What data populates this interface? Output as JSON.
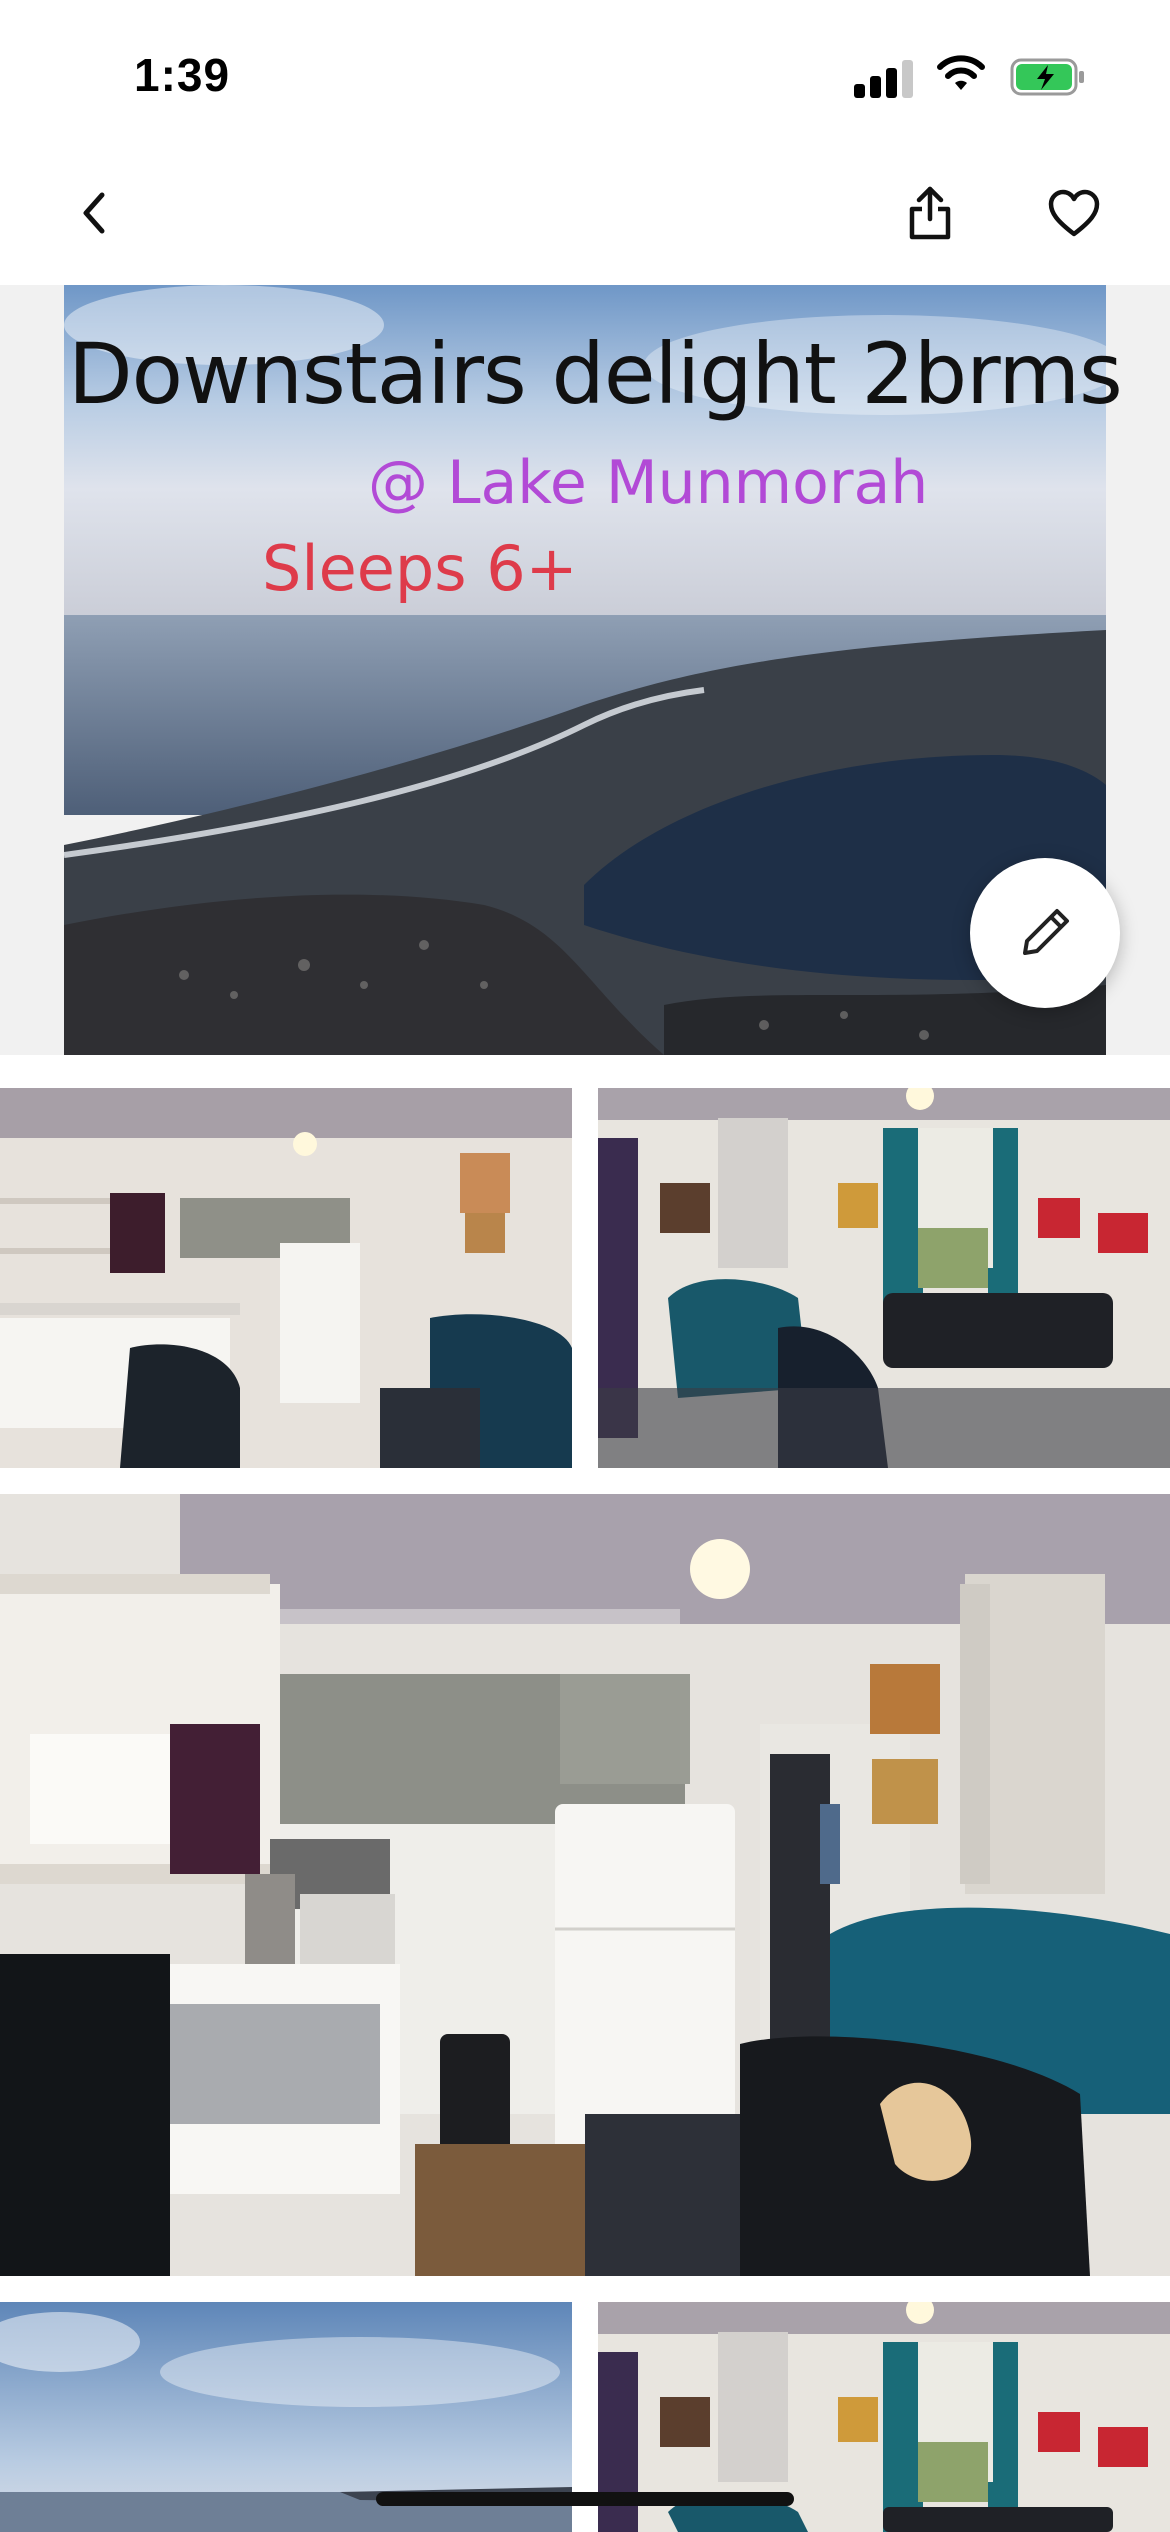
{
  "status_bar": {
    "time": "1:39"
  },
  "nav": {
    "back_icon": "chevron-left-icon",
    "share_icon": "share-icon",
    "favorite_icon": "heart-icon"
  },
  "hero": {
    "title": "Downstairs delight 2brms",
    "subtitle": "@ Lake Munmorah",
    "sleeps": "Sleeps 6+",
    "edit_icon": "pencil-icon"
  },
  "colors": {
    "subtitle": "#b24ad6",
    "sleeps": "#de3b4a",
    "battery": "#34c759"
  }
}
